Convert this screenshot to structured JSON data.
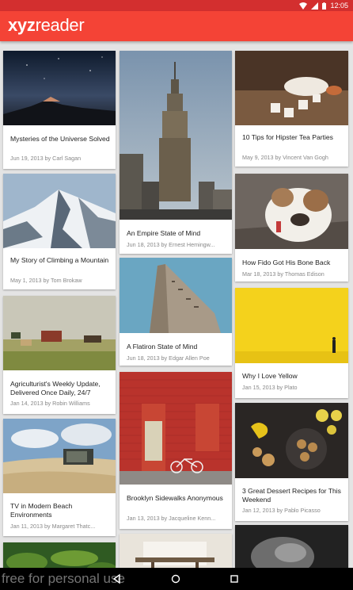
{
  "status_bar": {
    "time": "12:05",
    "icons": [
      "wifi-icon",
      "signal-icon",
      "battery-icon"
    ]
  },
  "app": {
    "logo_bold": "xyz",
    "logo_light": "reader"
  },
  "articles": [
    {
      "title": "Mysteries of the Universe Solved",
      "meta": "Jun 19, 2013 by Carl Sagan",
      "image": "night-sky-mountain"
    },
    {
      "title": "An Empire State of Mind",
      "meta": "Jun 18, 2013 by Ernest Hemingw...",
      "image": "empire-state-building"
    },
    {
      "title": "10 Tips for Hipster Tea Parties",
      "meta": "May 9, 2013 by Vincent Van Gogh",
      "image": "tea-cups"
    },
    {
      "title": "My Story of Climbing a Mountain",
      "meta": "May 1, 2013 by Tom Brokaw",
      "image": "snowy-mountain"
    },
    {
      "title": "A Flatiron State of Mind",
      "meta": "Jun 18, 2013 by Edgar Allen Poe",
      "image": "flatiron-building"
    },
    {
      "title": "How Fido Got His Bone Back",
      "meta": "Mar 18, 2013 by Thomas Edison",
      "image": "bulldog"
    },
    {
      "title": "Agriculturist's Weekly Update, Delivered Once Daily, 24/7",
      "meta": "Jan 14, 2013 by Robin Williams",
      "image": "farm-field-horses"
    },
    {
      "title": "Brooklyn Sidewalks Anonymous",
      "meta": "Jan 13, 2013 by Jacqueline Kenn...",
      "image": "red-brick-wall-bicycle"
    },
    {
      "title": "Why I Love Yellow",
      "meta": "Jan 15, 2013 by Plato",
      "image": "yellow-wall"
    },
    {
      "title": "TV in Modern Beach Environments",
      "meta": "Jan 11, 2013 by Margaret Thatc...",
      "image": "beach-tv"
    },
    {
      "title": "3 Great Dessert Recipes for This Weekend",
      "meta": "Jan 12, 2013 by Pablo Picasso",
      "image": "dessert-cookies-lemons"
    }
  ],
  "partial_cards": [
    "green-leaves",
    "dining-room",
    "underwater-bw"
  ],
  "nav_bar": {
    "buttons": [
      "back-icon",
      "home-icon",
      "recents-icon"
    ]
  },
  "watermark": "free for personal use",
  "colors": {
    "status_bar": "#d32f2f",
    "app_bar": "#f44336",
    "background": "#e4e4e4"
  }
}
